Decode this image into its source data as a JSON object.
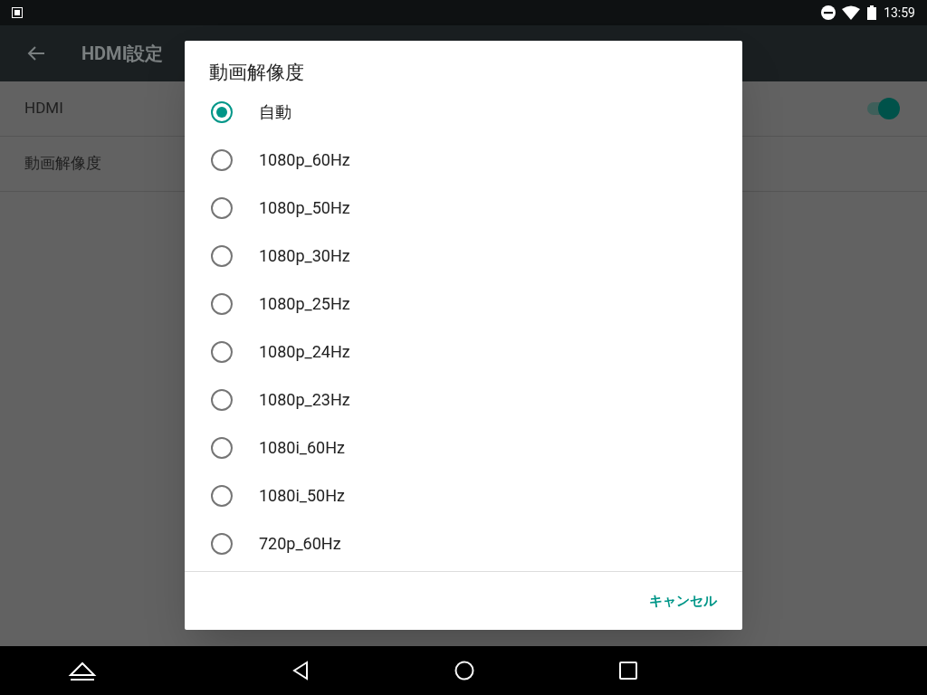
{
  "status_bar": {
    "time": "13:59"
  },
  "app_bar": {
    "title": "HDMI設定"
  },
  "settings": [
    {
      "kind": "switch",
      "label": "HDMI",
      "on": true
    },
    {
      "kind": "plain",
      "label": "動画解像度"
    }
  ],
  "dialog": {
    "title": "動画解像度",
    "options": [
      {
        "label": "自動",
        "selected": true
      },
      {
        "label": "1080p_60Hz",
        "selected": false
      },
      {
        "label": "1080p_50Hz",
        "selected": false
      },
      {
        "label": "1080p_30Hz",
        "selected": false
      },
      {
        "label": "1080p_25Hz",
        "selected": false
      },
      {
        "label": "1080p_24Hz",
        "selected": false
      },
      {
        "label": "1080p_23Hz",
        "selected": false
      },
      {
        "label": "1080i_60Hz",
        "selected": false
      },
      {
        "label": "1080i_50Hz",
        "selected": false
      },
      {
        "label": "720p_60Hz",
        "selected": false
      }
    ],
    "cancel": "キャンセル"
  }
}
